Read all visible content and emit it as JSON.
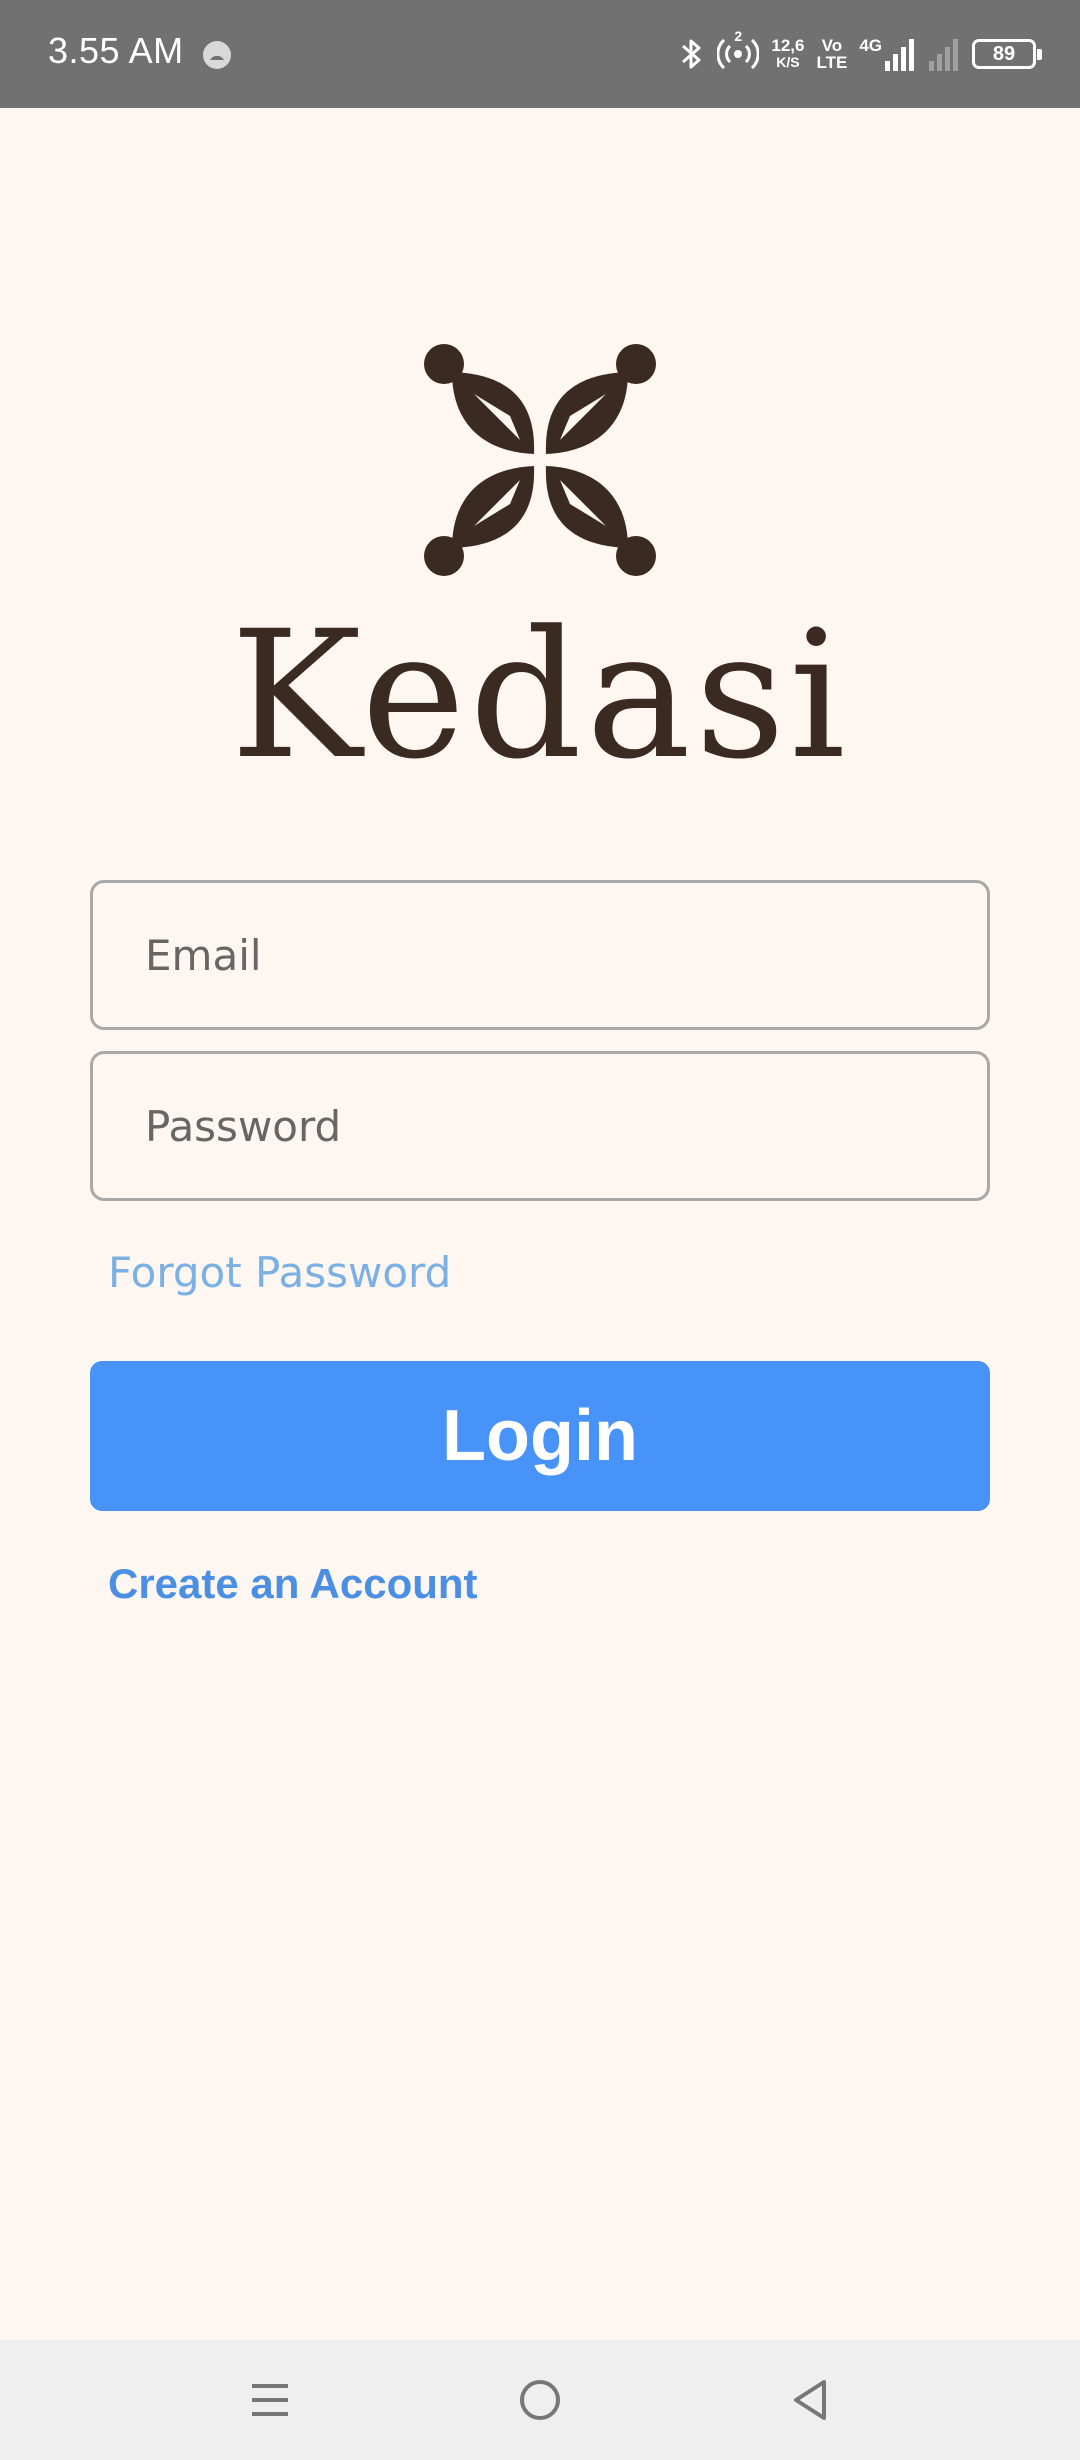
{
  "status_bar": {
    "time": "3.55 AM",
    "net_speed_value": "12,6",
    "net_speed_unit": "K/S",
    "volte_top": "Vo",
    "volte_bottom": "LTE",
    "network_type": "4G",
    "battery_level": "89",
    "hotspot_badge": "2"
  },
  "brand": {
    "name": "Kedasi",
    "color": "#3b2a22"
  },
  "login_form": {
    "email_placeholder": "Email",
    "password_placeholder": "Password",
    "forgot_password_label": "Forgot Password",
    "login_button_label": "Login",
    "create_account_label": "Create an Account"
  },
  "colors": {
    "background": "#fdf6f1",
    "primary_button": "#4793f8",
    "link": "#4a8fe3",
    "link_light": "#7ab0e3",
    "status_bar": "#717171",
    "nav_bar": "#efefef"
  },
  "nav_bar": {
    "icons": [
      "menu-icon",
      "home-icon",
      "back-icon"
    ]
  }
}
